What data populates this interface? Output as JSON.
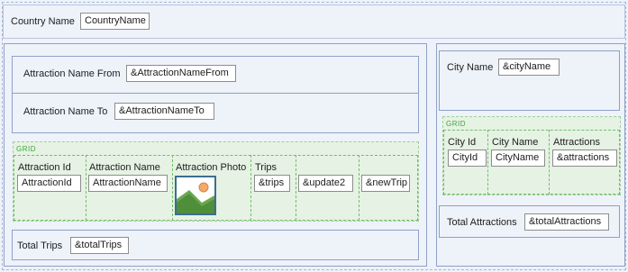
{
  "country": {
    "label": "Country Name",
    "field": "CountryName"
  },
  "left": {
    "attraction_name_from": {
      "label": "Attraction Name From",
      "field": "&AttractionNameFrom"
    },
    "attraction_name_to": {
      "label": "Attraction Name To",
      "field": "&AttractionNameTo"
    },
    "grid": {
      "tag": "GRID",
      "columns": [
        {
          "header": "Attraction Id",
          "field": "AttractionId"
        },
        {
          "header": "Attraction Name",
          "field": "AttractionName"
        },
        {
          "header": "Attraction Photo",
          "icon": "image-placeholder-icon"
        },
        {
          "header": "Trips",
          "field": "&trips"
        },
        {
          "header": "",
          "field": "&update2"
        },
        {
          "header": "",
          "field": "&newTrip"
        }
      ]
    },
    "total_trips": {
      "label": "Total Trips",
      "field": "&totalTrips"
    }
  },
  "right": {
    "city_name": {
      "label": "City Name",
      "field": "&cityName"
    },
    "grid": {
      "tag": "GRID",
      "columns": [
        {
          "header": "City Id",
          "field": "CityId"
        },
        {
          "header": "City Name",
          "field": "CityName"
        },
        {
          "header": "Attractions",
          "field": "&attractions"
        }
      ]
    },
    "total_attractions": {
      "label": "Total Attractions",
      "field": "&totalAttractions"
    }
  },
  "colors": {
    "grid_tag": "#3aa835",
    "panel_border": "#8fa1c8",
    "grid_bg": "#e6f2e4",
    "photo_border": "#3c6e92"
  }
}
